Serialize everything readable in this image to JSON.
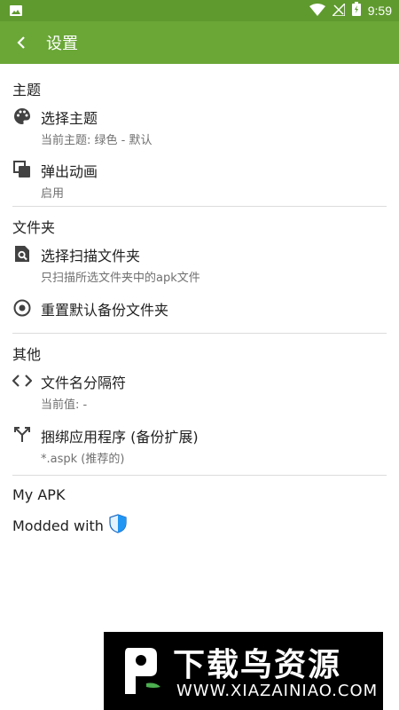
{
  "status_bar": {
    "time": "9:59"
  },
  "toolbar": {
    "title": "设置"
  },
  "sections": {
    "theme": {
      "header": "主题",
      "choose_theme": {
        "title": "选择主题",
        "subtitle": "当前主题: 绿色 - 默认"
      },
      "popup_animation": {
        "title": "弹出动画",
        "subtitle": "启用"
      }
    },
    "folder": {
      "header": "文件夹",
      "scan_folder": {
        "title": "选择扫描文件夹",
        "subtitle": "只扫描所选文件夹中的apk文件"
      },
      "reset_backup": {
        "title": "重置默认备份文件夹"
      }
    },
    "other": {
      "header": "其他",
      "filename_separator": {
        "title": "文件名分隔符",
        "subtitle": "当前值: -"
      },
      "bundle_apps": {
        "title": "捆绑应用程序 (备份扩展)",
        "subtitle": "*.aspk (推荐的)"
      }
    }
  },
  "footer": {
    "app_name": "My APK",
    "modded_with": "Modded with"
  },
  "watermark": {
    "title": "下载鸟资源",
    "url": "WWW.XIAZAINIAO.COM"
  },
  "colors": {
    "toolbar": "#6aa737",
    "status_bar": "#5f9a2e",
    "icon": "#424242",
    "shield": "#2196f3"
  }
}
